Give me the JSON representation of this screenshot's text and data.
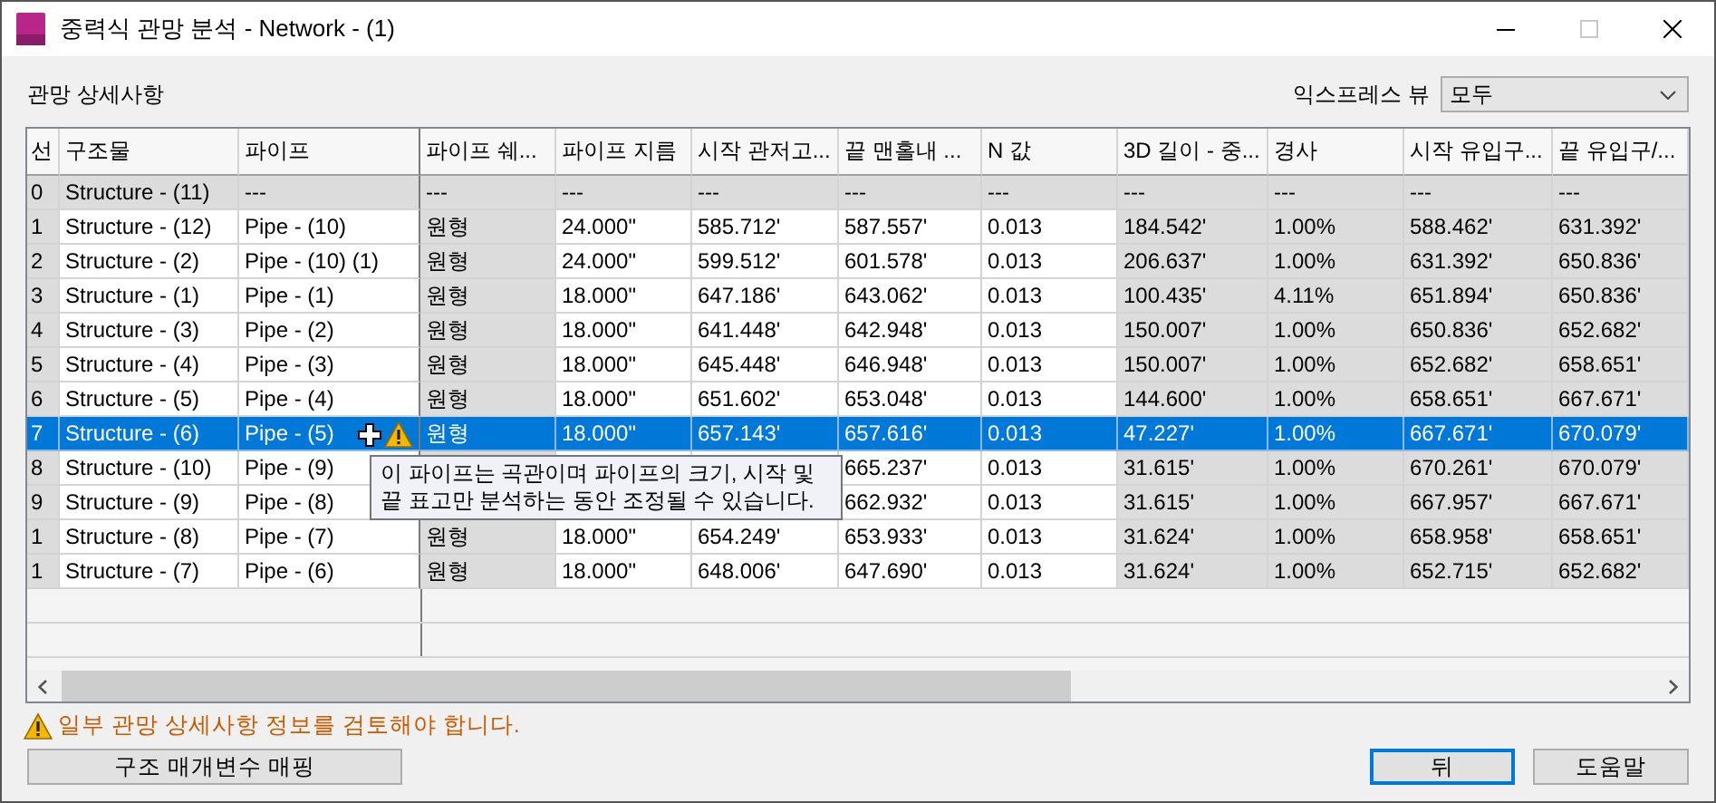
{
  "window": {
    "title": "중력식 관망 분석 - Network - (1)",
    "maximize_disabled": true
  },
  "section_label": "관망 상세사항",
  "express_view": {
    "label": "익스프레스 뷰",
    "value": "모두"
  },
  "table": {
    "columns": [
      {
        "label": "선",
        "readonly": true
      },
      {
        "label": "구조물",
        "readonly": false
      },
      {
        "label": "파이프",
        "readonly": false
      },
      {
        "label": "파이프 쉐...",
        "readonly": true
      },
      {
        "label": "파이프 지름",
        "readonly": false
      },
      {
        "label": "시작 관저고...",
        "readonly": false
      },
      {
        "label": "끝 맨홀내 ...",
        "readonly": false
      },
      {
        "label": "N 값",
        "readonly": false
      },
      {
        "label": "3D 길이 - 중...",
        "readonly": true
      },
      {
        "label": "경사",
        "readonly": true
      },
      {
        "label": "시작 유입구...",
        "readonly": true
      },
      {
        "label": "끝 유입구/...",
        "readonly": true
      }
    ],
    "rows": [
      {
        "selected": false,
        "readonly": true,
        "warning": false,
        "cells": [
          "0",
          "Structure - (11)",
          "---",
          "---",
          "---",
          "---",
          "---",
          "---",
          "---",
          "---",
          "---",
          "---"
        ]
      },
      {
        "selected": false,
        "readonly": false,
        "warning": false,
        "cells": [
          "1",
          "Structure - (12)",
          "Pipe - (10)",
          "원형",
          "24.000\"",
          "585.712'",
          "587.557'",
          "0.013",
          "184.542'",
          "1.00%",
          "588.462'",
          "631.392'"
        ]
      },
      {
        "selected": false,
        "readonly": false,
        "warning": false,
        "cells": [
          "2",
          "Structure - (2)",
          "Pipe - (10) (1)",
          "원형",
          "24.000\"",
          "599.512'",
          "601.578'",
          "0.013",
          "206.637'",
          "1.00%",
          "631.392'",
          "650.836'"
        ]
      },
      {
        "selected": false,
        "readonly": false,
        "warning": false,
        "cells": [
          "3",
          "Structure - (1)",
          "Pipe - (1)",
          "원형",
          "18.000\"",
          "647.186'",
          "643.062'",
          "0.013",
          "100.435'",
          "4.11%",
          "651.894'",
          "650.836'"
        ]
      },
      {
        "selected": false,
        "readonly": false,
        "warning": false,
        "cells": [
          "4",
          "Structure - (3)",
          "Pipe - (2)",
          "원형",
          "18.000\"",
          "641.448'",
          "642.948'",
          "0.013",
          "150.007'",
          "1.00%",
          "650.836'",
          "652.682'"
        ]
      },
      {
        "selected": false,
        "readonly": false,
        "warning": false,
        "cells": [
          "5",
          "Structure - (4)",
          "Pipe - (3)",
          "원형",
          "18.000\"",
          "645.448'",
          "646.948'",
          "0.013",
          "150.007'",
          "1.00%",
          "652.682'",
          "658.651'"
        ]
      },
      {
        "selected": false,
        "readonly": false,
        "warning": false,
        "cells": [
          "6",
          "Structure - (5)",
          "Pipe - (4)",
          "원형",
          "18.000\"",
          "651.602'",
          "653.048'",
          "0.013",
          "144.600'",
          "1.00%",
          "658.651'",
          "667.671'"
        ]
      },
      {
        "selected": true,
        "readonly": false,
        "warning": true,
        "cells": [
          "7",
          "Structure - (6)",
          "Pipe - (5)",
          "원형",
          "18.000\"",
          "657.143'",
          "657.616'",
          "0.013",
          "47.227'",
          "1.00%",
          "667.671'",
          "670.079'"
        ]
      },
      {
        "selected": false,
        "readonly": false,
        "warning": false,
        "cells": [
          "8",
          "Structure - (10)",
          "Pipe - (9)",
          null,
          null,
          null,
          "665.237'",
          "0.013",
          "31.615'",
          "1.00%",
          "670.261'",
          "670.079'"
        ]
      },
      {
        "selected": false,
        "readonly": false,
        "warning": false,
        "cells": [
          "9",
          "Structure - (9)",
          "Pipe - (8)",
          null,
          null,
          null,
          "662.932'",
          "0.013",
          "31.615'",
          "1.00%",
          "667.957'",
          "667.671'"
        ]
      },
      {
        "selected": false,
        "readonly": false,
        "warning": false,
        "cells": [
          "1",
          "Structure - (8)",
          "Pipe - (7)",
          "원형",
          "18.000\"",
          "654.249'",
          "653.933'",
          "0.013",
          "31.624'",
          "1.00%",
          "658.958'",
          "658.651'"
        ]
      },
      {
        "selected": false,
        "readonly": false,
        "warning": false,
        "cells": [
          "1",
          "Structure - (7)",
          "Pipe - (6)",
          "원형",
          "18.000\"",
          "648.006'",
          "647.690'",
          "0.013",
          "31.624'",
          "1.00%",
          "652.715'",
          "652.682'"
        ]
      }
    ]
  },
  "tooltip": "이 파이프는 곡관이며 파이프의 크기, 시작 및\n끝 표고만 분석하는 동안 조정될 수 있습니다.",
  "warning_message": "일부 관망 상세사항 정보를 검토해야 합니다.",
  "buttons": [
    {
      "label": "구조 매개변수 매핑",
      "default": false
    },
    {
      "label": "뒤",
      "default": true
    },
    {
      "label": "도움말",
      "default": false
    }
  ]
}
